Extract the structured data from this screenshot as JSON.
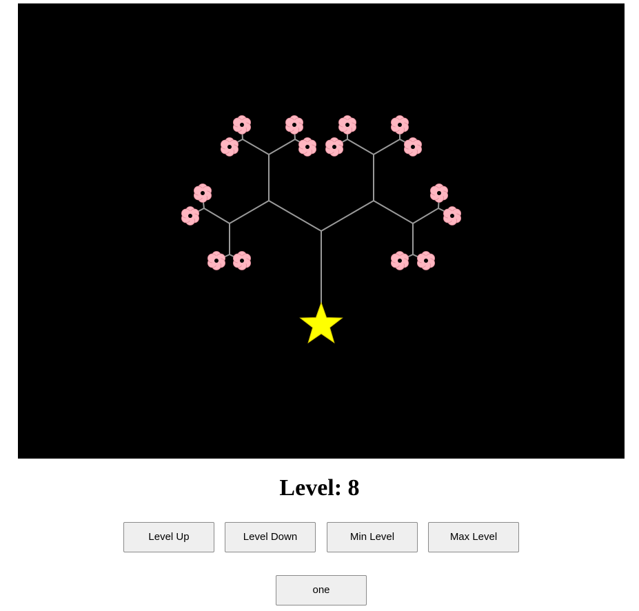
{
  "canvas": {
    "background": "#000000",
    "branch_color": "#9a9a9a",
    "flower_petal_color": "#ffb6c1",
    "flower_center_color": "#000000",
    "star_color": "#ffff00",
    "root_icon": "star-icon",
    "leaf_icon": "flower-icon"
  },
  "status": {
    "level_label": "Level: 8",
    "level": 8
  },
  "controls": {
    "level_up": "Level Up",
    "level_down": "Level Down",
    "min_level": "Min Level",
    "max_level": "Max Level",
    "mode": "one"
  }
}
